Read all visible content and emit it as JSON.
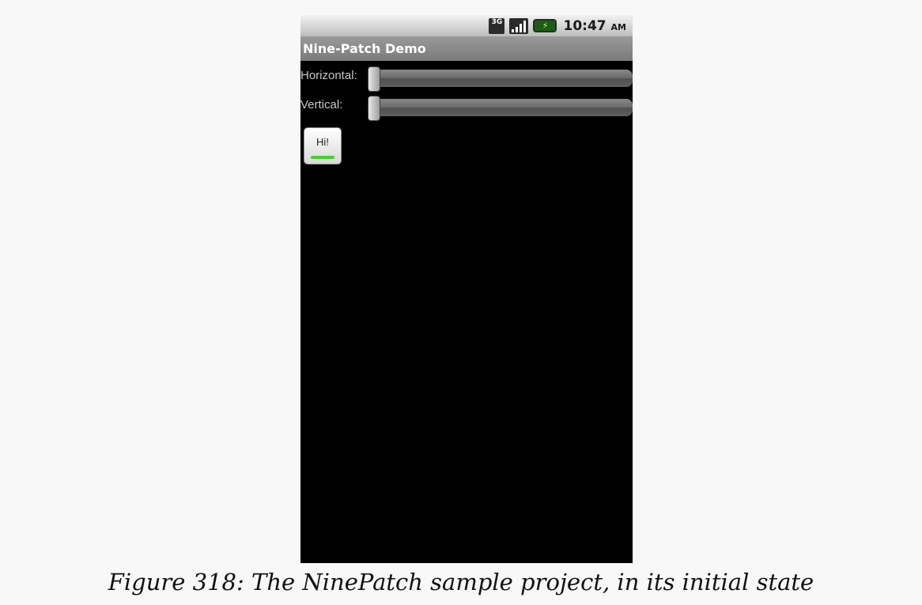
{
  "statusbar": {
    "icons": [
      "3g-icon",
      "signal-icon",
      "battery-icon"
    ],
    "network_label": "3G",
    "clock": "10:47",
    "clock_suffix": "AM"
  },
  "app": {
    "title": "Nine-Patch Demo"
  },
  "controls": {
    "horizontal_label": "Horizontal:",
    "horizontal_value": 0,
    "vertical_label": "Vertical:",
    "vertical_value": 0,
    "button_label": "Hi!"
  },
  "caption": "Figure 318: The NinePatch sample project, in its initial state",
  "colors": {
    "screen_background": "#000000",
    "title_bar": "#8a8a8a",
    "button_accent": "#47d02e"
  }
}
